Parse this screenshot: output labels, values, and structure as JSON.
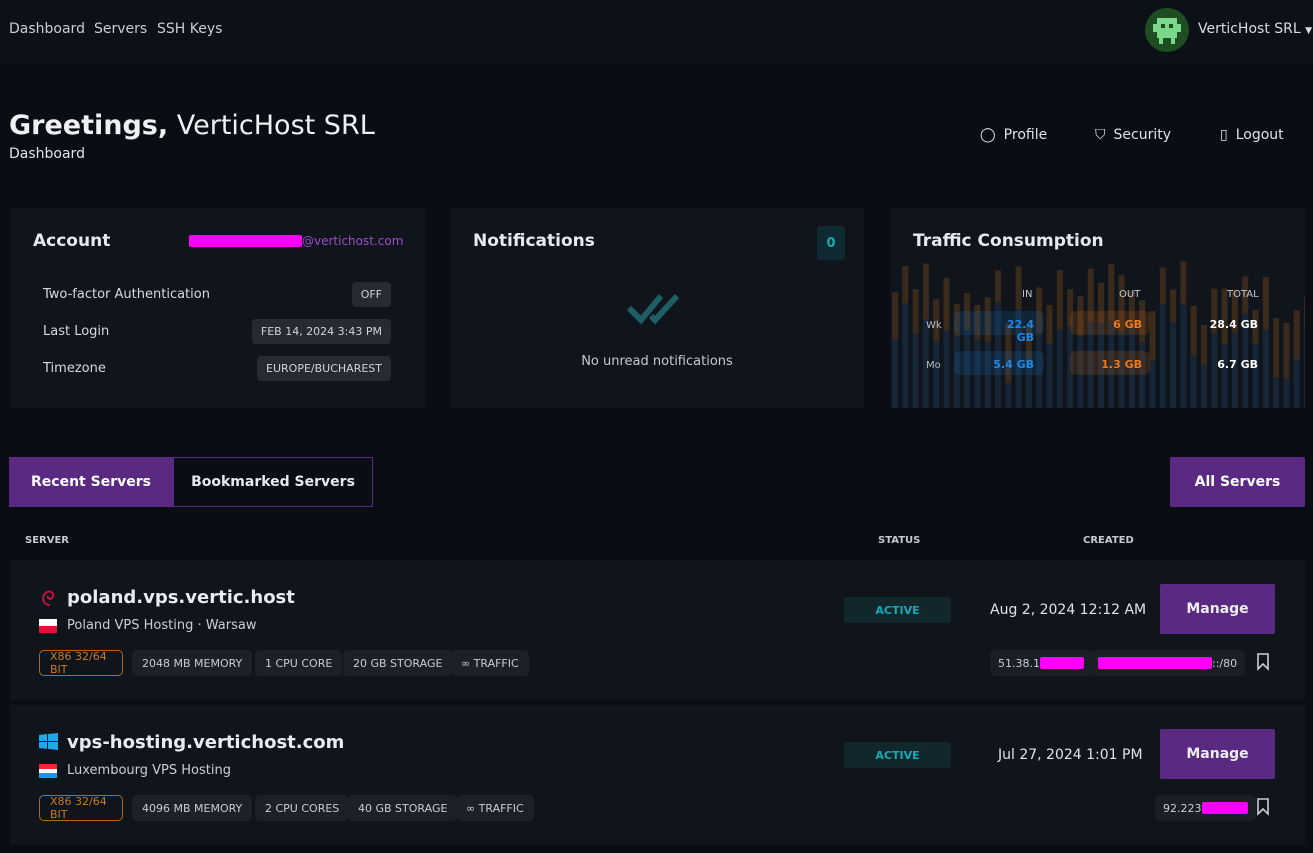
{
  "nav": {
    "items": [
      "Dashboard",
      "Servers",
      "SSH Keys"
    ],
    "user": "VerticHost SRL"
  },
  "header": {
    "greeting": "Greetings,",
    "name": "VerticHost SRL",
    "subtitle": "Dashboard",
    "links": [
      "Profile",
      "Security",
      "Logout"
    ]
  },
  "account": {
    "title": "Account",
    "email_suffix": "@vertichost.com",
    "rows": [
      {
        "label": "Two-factor Authentication",
        "value": "OFF"
      },
      {
        "label": "Last Login",
        "value": "FEB 14, 2024 3:43 PM"
      },
      {
        "label": "Timezone",
        "value": "EUROPE/BUCHAREST"
      }
    ]
  },
  "notifications": {
    "title": "Notifications",
    "count": "0",
    "empty": "No unread notifications"
  },
  "traffic": {
    "title": "Traffic Consumption",
    "cols": [
      "IN",
      "OUT",
      "TOTAL"
    ],
    "rows": [
      {
        "label": "Wk",
        "in": "22.4 GB",
        "out": "6 GB",
        "total": "28.4 GB"
      },
      {
        "label": "Mo",
        "in": "5.4 GB",
        "out": "1.3 GB",
        "total": "6.7 GB"
      }
    ],
    "colors": {
      "in": "#1e88e5",
      "out": "#f07a1a"
    }
  },
  "tabs": {
    "recent": "Recent Servers",
    "bookmarked": "Bookmarked Servers",
    "all": "All Servers"
  },
  "table": {
    "headers": [
      "SERVER",
      "STATUS",
      "CREATED"
    ]
  },
  "servers": [
    {
      "name": "poland.vps.vertic.host",
      "os": "debian-icon",
      "location": "Poland VPS Hosting · Warsaw",
      "tags": [
        "X86 32/64 BIT",
        "2048 MB MEMORY",
        "1 CPU CORE",
        "20 GB STORAGE",
        "∞ TRAFFIC"
      ],
      "status": "ACTIVE",
      "created": "Aug 2, 2024 12:12 AM",
      "manage": "Manage",
      "ip": "51.38.1",
      "ip6_suffix": "::/80"
    },
    {
      "name": "vps-hosting.vertichost.com",
      "os": "windows-icon",
      "location": "Luxembourg VPS Hosting",
      "tags": [
        "X86 32/64 BIT",
        "4096 MB MEMORY",
        "2 CPU CORES",
        "40 GB STORAGE",
        "∞ TRAFFIC"
      ],
      "status": "ACTIVE",
      "created": "Jul 27, 2024 1:01 PM",
      "manage": "Manage",
      "ip": "92.223"
    }
  ]
}
